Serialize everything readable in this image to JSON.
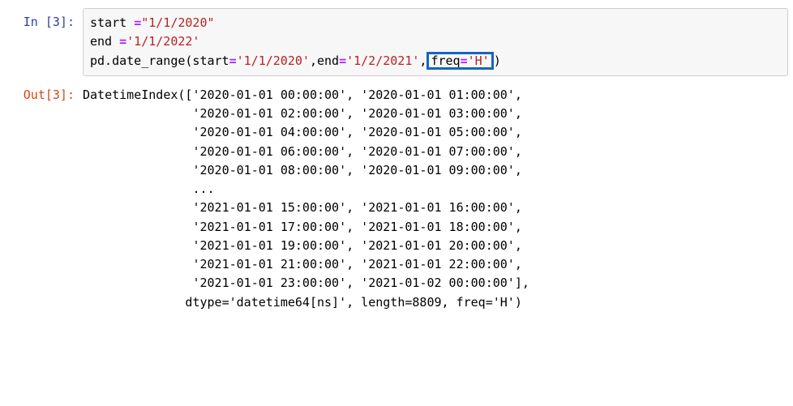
{
  "input_cell": {
    "prompt": "In [3]:",
    "line1": {
      "var": "start ",
      "eq": "=",
      "str": "\"1/1/2020\""
    },
    "line2": {
      "var": "end ",
      "eq": "=",
      "str": "'1/1/2022'"
    },
    "line3": {
      "call_pre": "pd.date_range(start",
      "eq1": "=",
      "arg1_str": "'1/1/2020'",
      "comma1": ",end",
      "eq2": "=",
      "arg2_str": "'1/2/2021'",
      "comma2": ",",
      "kw_freq": "freq",
      "eq3": "=",
      "arg3_str": "'H'",
      "close": ")"
    }
  },
  "output_cell": {
    "prompt": "Out[3]:",
    "lines": [
      "DatetimeIndex(['2020-01-01 00:00:00', '2020-01-01 01:00:00',",
      "               '2020-01-01 02:00:00', '2020-01-01 03:00:00',",
      "               '2020-01-01 04:00:00', '2020-01-01 05:00:00',",
      "               '2020-01-01 06:00:00', '2020-01-01 07:00:00',",
      "               '2020-01-01 08:00:00', '2020-01-01 09:00:00',",
      "               ...",
      "               '2021-01-01 15:00:00', '2021-01-01 16:00:00',",
      "               '2021-01-01 17:00:00', '2021-01-01 18:00:00',",
      "               '2021-01-01 19:00:00', '2021-01-01 20:00:00',",
      "               '2021-01-01 21:00:00', '2021-01-01 22:00:00',",
      "               '2021-01-01 23:00:00', '2021-01-02 00:00:00'],",
      "              dtype='datetime64[ns]', length=8809, freq='H')"
    ]
  }
}
